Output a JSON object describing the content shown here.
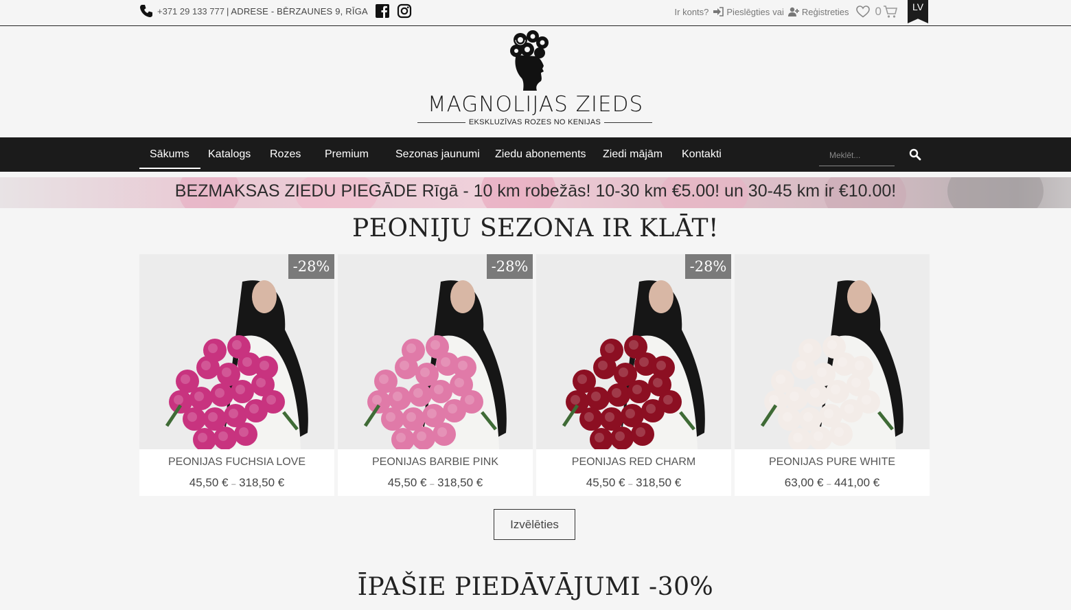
{
  "topbar": {
    "phone": "+371 29 133 777",
    "separator": "|",
    "address": "ADRESE - BĒRZAUNES 9, RĪGA",
    "account_question": "Ir konts?",
    "login_label": "Pieslēgties",
    "or_label": "vai",
    "register_label": "Reģistreties",
    "cart_count": "0",
    "language": "LV"
  },
  "logo": {
    "name": "MAGNOLIJAS ZIEDS",
    "tagline": "EKSKLUZĪVAS ROZES NO KENIJAS"
  },
  "nav": {
    "items": [
      "Sākums",
      "Katalogs",
      "Rozes",
      "Premium",
      "Sezonas jaunumi",
      "Ziedu abonements",
      "Ziedi mājām",
      "Kontakti"
    ],
    "active": "Sākums",
    "search_placeholder": "Meklēt..."
  },
  "banner": {
    "text": "BEZMAKSAS ZIEDU PIEGĀDE Rīgā - 10 km robežās! 10-30 km €5.00! un 30-45 km ir €10.00!"
  },
  "section1": {
    "heading": "PEONIJU SEZONA IR KLĀT!",
    "products": [
      {
        "title": "PEONIJAS FUCHSIA LOVE",
        "price_min": "45,50 €",
        "price_max": "318,50 €",
        "badge": "-28%",
        "flower_color": "#c8337f"
      },
      {
        "title": "PEONIJAS BARBIE PINK",
        "price_min": "45,50 €",
        "price_max": "318,50 €",
        "badge": "-28%",
        "flower_color": "#e07aa8"
      },
      {
        "title": "PEONIJAS RED CHARM",
        "price_min": "45,50 €",
        "price_max": "318,50 €",
        "badge": "-28%",
        "flower_color": "#8c0f22"
      },
      {
        "title": "PEONIJAS PURE WHITE",
        "price_min": "63,00 €",
        "price_max": "441,00 €",
        "badge": "",
        "flower_color": "#f3ece8"
      }
    ],
    "button_label": "Izvēlēties"
  },
  "section2": {
    "heading": "ĪPAŠIE PIEDĀVĀJUMI -30%"
  },
  "price_dash": "–"
}
